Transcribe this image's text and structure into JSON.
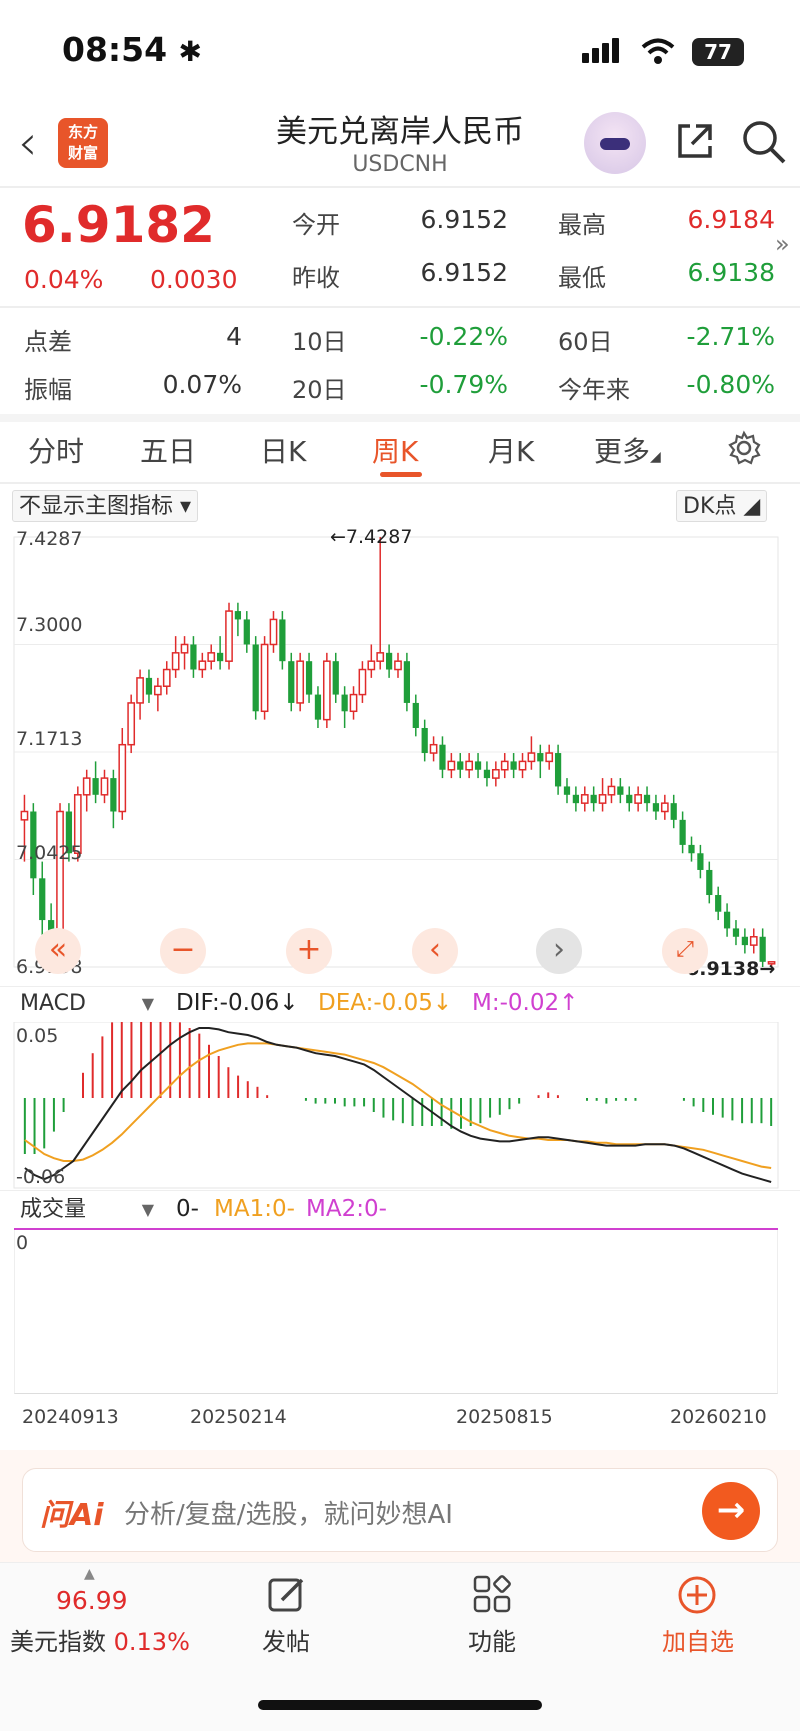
{
  "status_bar": {
    "time": "08:54",
    "battery": "77"
  },
  "header": {
    "back_icon": "chevron-left-icon",
    "logo_text_line1": "东方",
    "logo_text_line2": "财富",
    "title": "美元兑离岸人民币",
    "symbol": "USDCNH"
  },
  "quote": {
    "price": "6.9182",
    "change_pct": "0.04%",
    "change": "0.0030",
    "open_label": "今开",
    "open": "6.9152",
    "high_label": "最高",
    "high": "6.9184",
    "prev_close_label": "昨收",
    "prev_close": "6.9152",
    "low_label": "最低",
    "low": "6.9138",
    "spread_label": "点差",
    "spread": "4",
    "d10_label": "10日",
    "d10": "-0.22%",
    "d60_label": "60日",
    "d60": "-2.71%",
    "amplitude_label": "振幅",
    "amplitude": "0.07%",
    "d20_label": "20日",
    "d20": "-0.79%",
    "ytd_label": "今年来",
    "ytd": "-0.80%"
  },
  "tabs": [
    {
      "label": "分时"
    },
    {
      "label": "五日"
    },
    {
      "label": "日K"
    },
    {
      "label": "周K"
    },
    {
      "label": "月K"
    },
    {
      "label": "更多"
    }
  ],
  "active_tab": "周K",
  "chart_controls": {
    "indicator_select": "不显示主图指标",
    "dk_select": "DK点",
    "macd_select": "MACD",
    "volume_select": "成交量"
  },
  "colors": {
    "up": "#e02b2b",
    "down": "#1f9e3a",
    "accent": "#e8552a",
    "dea": "#f0a020",
    "m": "#d040d0"
  },
  "chart_data": [
    {
      "type": "candlestick",
      "y_tick_labels": [
        "7.4287",
        "7.3000",
        "7.1713",
        "7.0425",
        "6.9138"
      ],
      "ylim": [
        6.9138,
        7.4287
      ],
      "max_annotation": "7.4287",
      "min_annotation": "6.9138",
      "x_tick_labels": [
        "20240913",
        "20250214",
        "20250815",
        "20260210"
      ],
      "candles": [
        [
          7.09,
          7.1,
          7.04,
          7.12,
          1
        ],
        [
          7.1,
          7.02,
          7.0,
          7.11,
          0
        ],
        [
          7.02,
          6.97,
          6.95,
          7.04,
          0
        ],
        [
          6.97,
          6.94,
          6.93,
          6.99,
          0
        ],
        [
          6.94,
          7.1,
          6.93,
          7.11,
          1
        ],
        [
          7.1,
          7.05,
          7.04,
          7.11,
          0
        ],
        [
          7.05,
          7.12,
          7.04,
          7.13,
          1
        ],
        [
          7.12,
          7.14,
          7.1,
          7.15,
          1
        ],
        [
          7.14,
          7.12,
          7.11,
          7.16,
          0
        ],
        [
          7.12,
          7.14,
          7.11,
          7.15,
          1
        ],
        [
          7.14,
          7.1,
          7.08,
          7.15,
          0
        ],
        [
          7.1,
          7.18,
          7.09,
          7.2,
          1
        ],
        [
          7.18,
          7.23,
          7.17,
          7.24,
          1
        ],
        [
          7.23,
          7.26,
          7.21,
          7.27,
          1
        ],
        [
          7.26,
          7.24,
          7.23,
          7.27,
          0
        ],
        [
          7.24,
          7.25,
          7.22,
          7.26,
          1
        ],
        [
          7.25,
          7.27,
          7.24,
          7.28,
          1
        ],
        [
          7.27,
          7.29,
          7.26,
          7.31,
          1
        ],
        [
          7.29,
          7.3,
          7.27,
          7.31,
          1
        ],
        [
          7.3,
          7.27,
          7.26,
          7.31,
          0
        ],
        [
          7.27,
          7.28,
          7.26,
          7.29,
          1
        ],
        [
          7.28,
          7.29,
          7.27,
          7.3,
          1
        ],
        [
          7.29,
          7.28,
          7.27,
          7.31,
          0
        ],
        [
          7.28,
          7.34,
          7.27,
          7.35,
          1
        ],
        [
          7.34,
          7.33,
          7.31,
          7.35,
          0
        ],
        [
          7.33,
          7.3,
          7.29,
          7.34,
          0
        ],
        [
          7.3,
          7.22,
          7.21,
          7.31,
          0
        ],
        [
          7.22,
          7.3,
          7.21,
          7.31,
          1
        ],
        [
          7.3,
          7.33,
          7.29,
          7.34,
          1
        ],
        [
          7.33,
          7.28,
          7.27,
          7.34,
          0
        ],
        [
          7.28,
          7.23,
          7.22,
          7.29,
          0
        ],
        [
          7.23,
          7.28,
          7.22,
          7.29,
          1
        ],
        [
          7.28,
          7.24,
          7.23,
          7.29,
          0
        ],
        [
          7.24,
          7.21,
          7.2,
          7.25,
          0
        ],
        [
          7.21,
          7.28,
          7.2,
          7.29,
          1
        ],
        [
          7.28,
          7.24,
          7.23,
          7.29,
          0
        ],
        [
          7.24,
          7.22,
          7.2,
          7.25,
          0
        ],
        [
          7.22,
          7.24,
          7.21,
          7.25,
          1
        ],
        [
          7.24,
          7.27,
          7.23,
          7.28,
          1
        ],
        [
          7.27,
          7.28,
          7.26,
          7.3,
          1
        ],
        [
          7.28,
          7.29,
          7.27,
          7.43,
          1
        ],
        [
          7.29,
          7.27,
          7.26,
          7.3,
          0
        ],
        [
          7.27,
          7.28,
          7.26,
          7.29,
          1
        ],
        [
          7.28,
          7.23,
          7.22,
          7.29,
          0
        ],
        [
          7.23,
          7.2,
          7.19,
          7.24,
          0
        ],
        [
          7.2,
          7.17,
          7.16,
          7.21,
          0
        ],
        [
          7.17,
          7.18,
          7.16,
          7.19,
          1
        ],
        [
          7.18,
          7.15,
          7.14,
          7.19,
          0
        ],
        [
          7.15,
          7.16,
          7.14,
          7.17,
          1
        ],
        [
          7.16,
          7.15,
          7.14,
          7.17,
          0
        ],
        [
          7.15,
          7.16,
          7.14,
          7.17,
          1
        ],
        [
          7.16,
          7.15,
          7.14,
          7.17,
          0
        ],
        [
          7.15,
          7.14,
          7.13,
          7.16,
          0
        ],
        [
          7.14,
          7.15,
          7.13,
          7.16,
          1
        ],
        [
          7.15,
          7.16,
          7.14,
          7.17,
          1
        ],
        [
          7.16,
          7.15,
          7.14,
          7.17,
          0
        ],
        [
          7.15,
          7.16,
          7.14,
          7.17,
          1
        ],
        [
          7.16,
          7.17,
          7.15,
          7.19,
          1
        ],
        [
          7.17,
          7.16,
          7.14,
          7.18,
          0
        ],
        [
          7.16,
          7.17,
          7.15,
          7.18,
          1
        ],
        [
          7.17,
          7.13,
          7.12,
          7.18,
          0
        ],
        [
          7.13,
          7.12,
          7.11,
          7.14,
          0
        ],
        [
          7.12,
          7.11,
          7.1,
          7.13,
          0
        ],
        [
          7.11,
          7.12,
          7.1,
          7.13,
          1
        ],
        [
          7.12,
          7.11,
          7.1,
          7.13,
          0
        ],
        [
          7.11,
          7.12,
          7.1,
          7.14,
          1
        ],
        [
          7.12,
          7.13,
          7.11,
          7.14,
          1
        ],
        [
          7.13,
          7.12,
          7.11,
          7.14,
          0
        ],
        [
          7.12,
          7.11,
          7.1,
          7.13,
          0
        ],
        [
          7.11,
          7.12,
          7.1,
          7.13,
          1
        ],
        [
          7.12,
          7.11,
          7.1,
          7.13,
          0
        ],
        [
          7.11,
          7.1,
          7.09,
          7.12,
          0
        ],
        [
          7.1,
          7.11,
          7.09,
          7.12,
          1
        ],
        [
          7.11,
          7.09,
          7.08,
          7.12,
          0
        ],
        [
          7.09,
          7.06,
          7.05,
          7.1,
          0
        ],
        [
          7.06,
          7.05,
          7.04,
          7.07,
          0
        ],
        [
          7.05,
          7.03,
          7.02,
          7.06,
          0
        ],
        [
          7.03,
          7.0,
          6.99,
          7.04,
          0
        ],
        [
          7.0,
          6.98,
          6.97,
          7.01,
          0
        ],
        [
          6.98,
          6.96,
          6.95,
          6.99,
          0
        ],
        [
          6.96,
          6.95,
          6.94,
          6.97,
          0
        ],
        [
          6.95,
          6.94,
          6.93,
          6.96,
          0
        ],
        [
          6.94,
          6.95,
          6.93,
          6.96,
          1
        ],
        [
          6.95,
          6.92,
          6.91,
          6.96,
          0
        ],
        [
          6.92,
          6.918,
          6.914,
          6.92,
          1
        ]
      ]
    },
    {
      "type": "macd",
      "labels": {
        "dif": "DIF:-0.06",
        "dea": "DEA:-0.05",
        "m": "M:-0.02"
      },
      "arrows": {
        "dif": "↓",
        "dea": "↓",
        "m": "↑"
      },
      "y_tick_labels": [
        "0.05",
        "-0.06"
      ],
      "ylim": [
        -0.06,
        0.05
      ],
      "dif": [
        -0.05,
        -0.055,
        -0.058,
        -0.055,
        -0.05,
        -0.045,
        -0.035,
        -0.025,
        -0.015,
        -0.005,
        0.005,
        0.012,
        0.02,
        0.026,
        0.032,
        0.038,
        0.043,
        0.047,
        0.05,
        0.05,
        0.049,
        0.047,
        0.046,
        0.045,
        0.043,
        0.04,
        0.038,
        0.037,
        0.036,
        0.034,
        0.032,
        0.031,
        0.03,
        0.028,
        0.026,
        0.024,
        0.02,
        0.015,
        0.01,
        0.005,
        0.0,
        -0.005,
        -0.01,
        -0.015,
        -0.02,
        -0.024,
        -0.027,
        -0.029,
        -0.03,
        -0.031,
        -0.031,
        -0.03,
        -0.029,
        -0.028,
        -0.028,
        -0.029,
        -0.03,
        -0.031,
        -0.032,
        -0.033,
        -0.034,
        -0.034,
        -0.034,
        -0.034,
        -0.033,
        -0.033,
        -0.033,
        -0.034,
        -0.036,
        -0.039,
        -0.042,
        -0.045,
        -0.048,
        -0.051,
        -0.054,
        -0.056,
        -0.058,
        -0.06
      ],
      "dea": [
        -0.03,
        -0.035,
        -0.04,
        -0.043,
        -0.045,
        -0.045,
        -0.044,
        -0.041,
        -0.037,
        -0.032,
        -0.026,
        -0.019,
        -0.012,
        -0.005,
        0.002,
        0.009,
        0.016,
        0.022,
        0.027,
        0.031,
        0.034,
        0.036,
        0.038,
        0.039,
        0.039,
        0.039,
        0.038,
        0.037,
        0.036,
        0.035,
        0.034,
        0.033,
        0.032,
        0.031,
        0.029,
        0.027,
        0.025,
        0.022,
        0.018,
        0.014,
        0.01,
        0.005,
        0.0,
        -0.005,
        -0.009,
        -0.013,
        -0.017,
        -0.02,
        -0.023,
        -0.025,
        -0.027,
        -0.028,
        -0.029,
        -0.029,
        -0.03,
        -0.03,
        -0.03,
        -0.031,
        -0.031,
        -0.032,
        -0.032,
        -0.033,
        -0.033,
        -0.033,
        -0.033,
        -0.033,
        -0.033,
        -0.034,
        -0.035,
        -0.036,
        -0.037,
        -0.039,
        -0.041,
        -0.043,
        -0.045,
        -0.047,
        -0.049,
        -0.05
      ]
    },
    {
      "type": "volume",
      "labels": {
        "vol": "0-",
        "ma1": "MA1:0-",
        "ma2": "MA2:0-"
      },
      "y_tick_labels": [
        "0"
      ]
    }
  ],
  "ai_bar": {
    "logo": "问Ai",
    "placeholder": "分析/复盘/选股，就问妙想AI",
    "go_icon": "arrow-right-icon"
  },
  "bottom_nav": [
    {
      "value": "96.99",
      "label": "美元指数",
      "pct": "0.13%"
    },
    {
      "label": "发帖",
      "icon": "edit-icon"
    },
    {
      "label": "功能",
      "icon": "grid-icon"
    },
    {
      "label": "加自选",
      "icon": "plus-circle-icon"
    }
  ]
}
